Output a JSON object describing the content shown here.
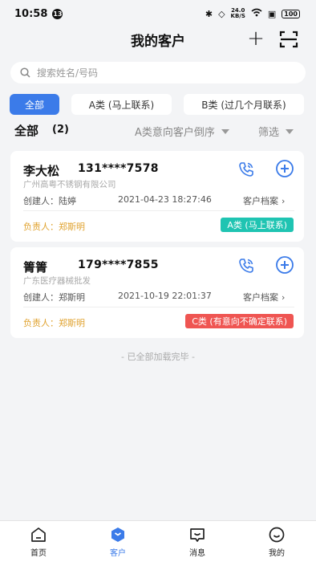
{
  "status_bar": {
    "time": "10:58",
    "notification_count": "13",
    "speed_value": "24.0",
    "speed_unit": "KB/S",
    "battery": "100"
  },
  "header": {
    "title": "我的客户"
  },
  "search": {
    "placeholder": "搜索姓名/号码"
  },
  "filters": [
    {
      "label": "全部",
      "active": true
    },
    {
      "label": "A类 (马上联系)",
      "active": false
    },
    {
      "label": "B类 (过几个月联系)",
      "active": false
    }
  ],
  "section": {
    "label": "全部",
    "count": "(2)",
    "sort_label": "A类意向客户倒序",
    "filter_label": "筛选"
  },
  "customers": [
    {
      "name": "李大松",
      "phone": "131****7578",
      "company": "广州高粤不锈钢有限公司",
      "creator": "创建人：陆婷",
      "created_at": "2021-04-23 18:27:46",
      "archive_label": "客户档案",
      "owner": "负责人：郑斯明",
      "tag": "A类 (马上联系)",
      "tag_color": "#1fc4b2"
    },
    {
      "name": "箐箐",
      "phone": "179****7855",
      "company": "广东医疗器械批发",
      "creator": "创建人：郑斯明",
      "created_at": "2021-10-19 22:01:37",
      "archive_label": "客户档案",
      "owner": "负责人：郑斯明",
      "tag": "C类 (有意向不确定联系)",
      "tag_color": "#ef5552"
    }
  ],
  "list_end": "- 已全部加载完毕 -",
  "bottom_nav": [
    {
      "label": "首页",
      "icon": "home-icon",
      "active": false
    },
    {
      "label": "客户",
      "icon": "customer-icon",
      "active": true
    },
    {
      "label": "消息",
      "icon": "message-icon",
      "active": false
    },
    {
      "label": "我的",
      "icon": "profile-icon",
      "active": false
    }
  ],
  "colors": {
    "accent": "#3b7be9",
    "owner_text": "#e0a22e"
  }
}
